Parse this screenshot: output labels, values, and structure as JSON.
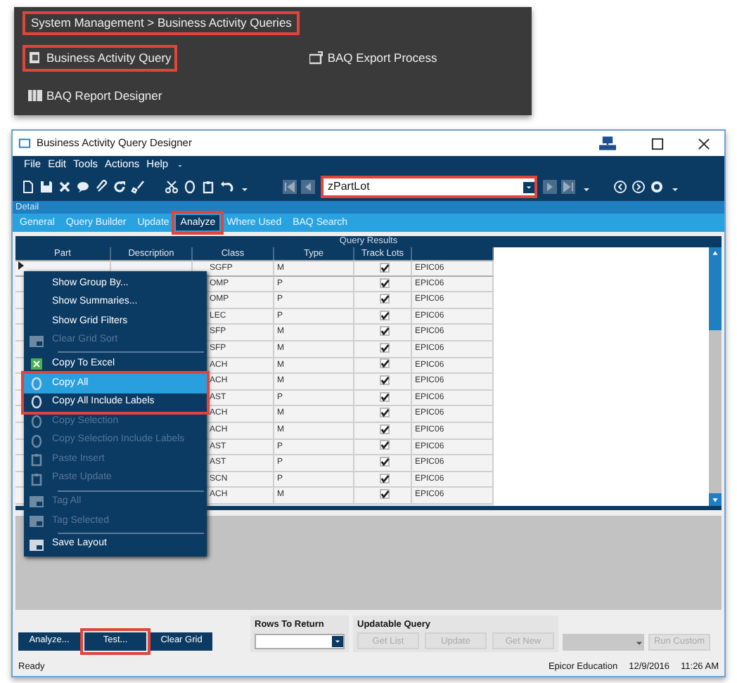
{
  "launcher": {
    "breadcrumb": {
      "text": "System Management > Business Activity Queries",
      "callout": true
    },
    "links": [
      {
        "label": "Business Activity Query",
        "kind": "query",
        "callout": true
      },
      {
        "label": "BAQ Export Process",
        "kind": "export",
        "callout": false
      },
      {
        "label": "BAQ Report Designer",
        "kind": "report",
        "callout": false
      }
    ]
  },
  "window": {
    "title": "Business Activity Query Designer",
    "menu": [
      "File",
      "Edit",
      "Tools",
      "Actions",
      "Help"
    ],
    "record_field": {
      "value": "zPartLot",
      "callout": true
    },
    "detail_label": "Detail",
    "tabs": [
      {
        "label": "General",
        "selected": false,
        "callout": false
      },
      {
        "label": "Query Builder",
        "selected": false,
        "callout": false
      },
      {
        "label": "Update",
        "selected": false,
        "callout": false
      },
      {
        "label": "Analyze",
        "selected": true,
        "callout": true
      },
      {
        "label": "Where Used",
        "selected": false,
        "callout": false
      },
      {
        "label": "BAQ Search",
        "selected": false,
        "callout": false
      }
    ],
    "results_title": "Query Results",
    "table": {
      "columns": [
        "Part",
        "Description",
        "Class",
        "Type",
        "Track Lots"
      ],
      "rows": [
        {
          "class": "SGFP",
          "type": "M",
          "track_lots": true,
          "column_6": "EPIC06",
          "current": true
        },
        {
          "class": "OMP",
          "type": "P",
          "track_lots": true,
          "column_6": "EPIC06",
          "current": false
        },
        {
          "class": "OMP",
          "type": "P",
          "track_lots": true,
          "column_6": "EPIC06",
          "current": false
        },
        {
          "class": "LEC",
          "type": "P",
          "track_lots": true,
          "column_6": "EPIC06",
          "current": false
        },
        {
          "class": "SFP",
          "type": "M",
          "track_lots": true,
          "column_6": "EPIC06",
          "current": false
        },
        {
          "class": "SFP",
          "type": "M",
          "track_lots": true,
          "column_6": "EPIC06",
          "current": false
        },
        {
          "class": "ACH",
          "type": "M",
          "track_lots": true,
          "column_6": "EPIC06",
          "current": false
        },
        {
          "class": "ACH",
          "type": "M",
          "track_lots": true,
          "column_6": "EPIC06",
          "current": false
        },
        {
          "class": "AST",
          "type": "P",
          "track_lots": true,
          "column_6": "EPIC06",
          "current": false
        },
        {
          "class": "ACH",
          "type": "M",
          "track_lots": true,
          "column_6": "EPIC06",
          "current": false
        },
        {
          "class": "ACH",
          "type": "M",
          "track_lots": true,
          "column_6": "EPIC06",
          "current": false
        },
        {
          "class": "AST",
          "type": "P",
          "track_lots": true,
          "column_6": "EPIC06",
          "current": false
        },
        {
          "class": "AST",
          "type": "P",
          "track_lots": true,
          "column_6": "EPIC06",
          "current": false
        },
        {
          "class": "SCN",
          "type": "P",
          "track_lots": true,
          "column_6": "EPIC06",
          "current": false
        },
        {
          "class": "ACH",
          "type": "M",
          "track_lots": true,
          "column_6": "EPIC06",
          "current": false
        }
      ]
    },
    "context_menu": [
      {
        "label": "Show Group By...",
        "kind": "plain",
        "disabled": false,
        "selected": false,
        "callout": false,
        "separator_before": false
      },
      {
        "label": "Show Summaries...",
        "kind": "plain",
        "disabled": false,
        "selected": false,
        "callout": false,
        "separator_before": false
      },
      {
        "label": "Show Grid Filters",
        "kind": "plain",
        "disabled": false,
        "selected": false,
        "callout": false,
        "separator_before": false
      },
      {
        "label": "Clear Grid Sort",
        "kind": "grid",
        "disabled": true,
        "selected": false,
        "callout": false,
        "separator_before": false
      },
      {
        "label": "Copy To Excel",
        "kind": "excel",
        "disabled": false,
        "selected": false,
        "callout": false,
        "separator_before": true
      },
      {
        "label": "Copy All",
        "kind": "copy",
        "disabled": false,
        "selected": true,
        "callout": true,
        "separator_before": false
      },
      {
        "label": "Copy All Include Labels",
        "kind": "copy",
        "disabled": false,
        "selected": false,
        "callout": true,
        "separator_before": false
      },
      {
        "label": "Copy Selection",
        "kind": "copy",
        "disabled": true,
        "selected": false,
        "callout": false,
        "separator_before": false
      },
      {
        "label": "Copy Selection Include Labels",
        "kind": "copy",
        "disabled": true,
        "selected": false,
        "callout": false,
        "separator_before": false
      },
      {
        "label": "Paste Insert",
        "kind": "paste",
        "disabled": true,
        "selected": false,
        "callout": false,
        "separator_before": false
      },
      {
        "label": "Paste Update",
        "kind": "paste",
        "disabled": true,
        "selected": false,
        "callout": false,
        "separator_before": false
      },
      {
        "label": "Tag All",
        "kind": "grid",
        "disabled": true,
        "selected": false,
        "callout": false,
        "separator_before": true
      },
      {
        "label": "Tag Selected",
        "kind": "grid",
        "disabled": true,
        "selected": false,
        "callout": false,
        "separator_before": false
      },
      {
        "label": "Save Layout",
        "kind": "grid",
        "disabled": false,
        "selected": false,
        "callout": false,
        "separator_before": true
      }
    ],
    "actions": [
      {
        "label": "Analyze...",
        "callout": false
      },
      {
        "label": "Test...",
        "callout": true
      },
      {
        "label": "Clear Grid",
        "callout": false
      }
    ],
    "rows_to_return": {
      "label": "Rows To Return"
    },
    "updatable_query": {
      "label": "Updatable Query",
      "buttons": [
        {
          "label": "Get List",
          "disabled": true
        },
        {
          "label": "Update",
          "disabled": true
        },
        {
          "label": "Get New",
          "disabled": true
        }
      ],
      "custom": {
        "label": "Run Custom",
        "disabled": true
      }
    },
    "status_bar": {
      "status": "Ready",
      "company": "Epicor Education",
      "date": "12/9/2016",
      "time": "11:26 AM"
    }
  }
}
